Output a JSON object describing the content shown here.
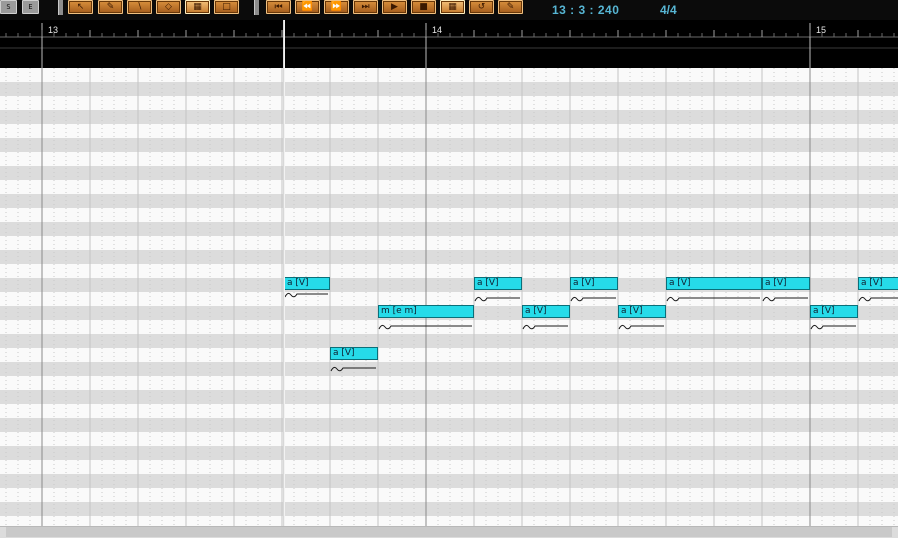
{
  "toolbar": {
    "start_button": "S",
    "end_button": "E",
    "tools": [
      "arrow-tool",
      "pencil-tool",
      "line-tool",
      "eraser-tool",
      "grid-snap-tool",
      "select-tool"
    ],
    "transport": [
      "rewind-start",
      "rewind",
      "fast-forward",
      "forward-end",
      "play",
      "stop",
      "grid-mode",
      "loop",
      "edit-mode"
    ],
    "position": "13 : 3 : 240",
    "time_signature": "4/4"
  },
  "ruler": {
    "measures": [
      "13",
      "14",
      "15"
    ]
  },
  "notes": [
    {
      "lyric": "a [V]"
    },
    {
      "lyric": "a [V]"
    },
    {
      "lyric": "m [e m]"
    },
    {
      "lyric": "a [V]"
    },
    {
      "lyric": "a [V]"
    },
    {
      "lyric": "a [V]"
    },
    {
      "lyric": "a [V]"
    },
    {
      "lyric": "a [V]"
    },
    {
      "lyric": "a [V]"
    },
    {
      "lyric": "a [V]"
    },
    {
      "lyric": "a [V]"
    }
  ],
  "colors": {
    "note_fill": "#26dbe9",
    "row_light": "#fafafa",
    "row_dark": "#dcdcdc",
    "ruler_bg": "#000000",
    "readout": "#57b6d4"
  }
}
